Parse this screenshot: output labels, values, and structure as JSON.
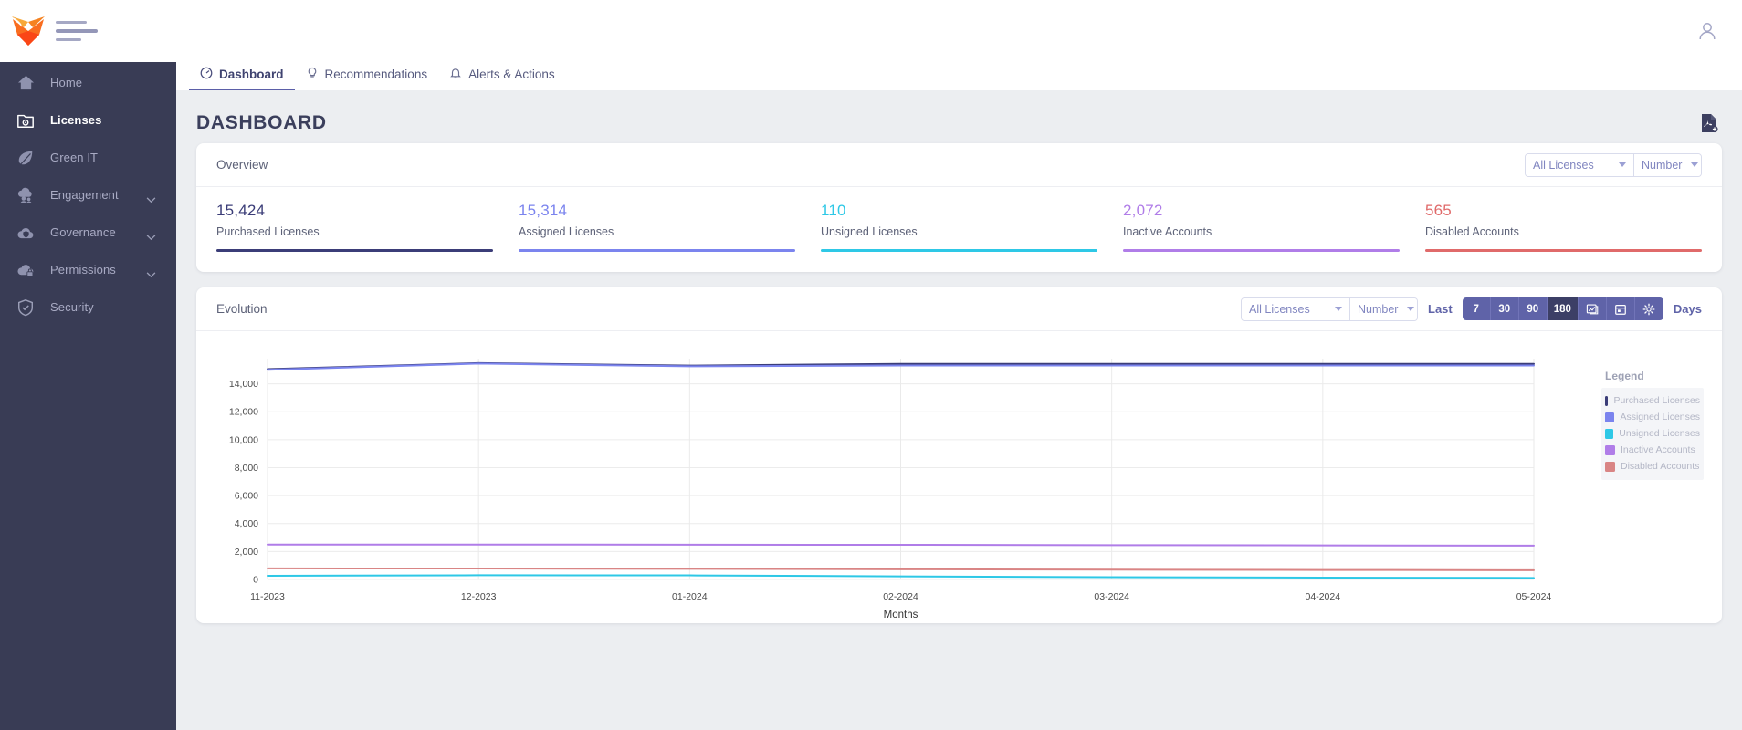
{
  "brand": {
    "logo_icon": "fox-logo",
    "menu_icon": "hamburger-lines"
  },
  "topbar": {
    "user_icon": "user-avatar-icon"
  },
  "sidebar": {
    "items": [
      {
        "label": "Home",
        "icon": "home-icon",
        "active": false,
        "expandable": false
      },
      {
        "label": "Licenses",
        "icon": "license-gear-icon",
        "active": true,
        "expandable": false
      },
      {
        "label": "Green IT",
        "icon": "leaf-icon",
        "active": false,
        "expandable": false
      },
      {
        "label": "Engagement",
        "icon": "people-cloud-icon",
        "active": false,
        "expandable": true
      },
      {
        "label": "Governance",
        "icon": "cloud-shield-icon",
        "active": false,
        "expandable": true
      },
      {
        "label": "Permissions",
        "icon": "cloud-lock-icon",
        "active": false,
        "expandable": true
      },
      {
        "label": "Security",
        "icon": "shield-check-icon",
        "active": false,
        "expandable": false
      }
    ]
  },
  "tabs": [
    {
      "label": "Dashboard",
      "icon": "gauge-icon",
      "active": true
    },
    {
      "label": "Recommendations",
      "icon": "lightbulb-icon",
      "active": false
    },
    {
      "label": "Alerts & Actions",
      "icon": "bell-icon",
      "active": false
    }
  ],
  "page": {
    "title": "DASHBOARD",
    "export_icon": "pdf-export-icon"
  },
  "overview": {
    "title": "Overview",
    "filter_license": "All Licenses",
    "filter_unit": "Number",
    "kpis": [
      {
        "value": "15,424",
        "label": "Purchased Licenses",
        "color": "#3b3d78"
      },
      {
        "value": "15,314",
        "label": "Assigned Licenses",
        "color": "#7b84ee"
      },
      {
        "value": "110",
        "label": "Unsigned Licenses",
        "color": "#2ec8e6"
      },
      {
        "value": "2,072",
        "label": "Inactive Accounts",
        "color": "#b07de8"
      },
      {
        "value": "565",
        "label": "Disabled Accounts",
        "color": "#e06a6a"
      }
    ]
  },
  "evolution": {
    "title": "Evolution",
    "filter_license": "All Licenses",
    "filter_unit": "Number",
    "last_label": "Last",
    "days_label": "Days",
    "ranges": [
      {
        "label": "7",
        "active": false
      },
      {
        "label": "30",
        "active": false
      },
      {
        "label": "90",
        "active": false
      },
      {
        "label": "180",
        "active": true
      }
    ],
    "extra_buttons": [
      {
        "icon": "chart-preset-icon"
      },
      {
        "icon": "calendar-icon"
      },
      {
        "icon": "gear-icon"
      }
    ],
    "legend_title": "Legend"
  },
  "chart_data": {
    "type": "line",
    "title": "Evolution",
    "xlabel": "Months",
    "ylabel": "",
    "categories": [
      "11-2023",
      "12-2023",
      "01-2024",
      "02-2024",
      "03-2024",
      "04-2024",
      "05-2024"
    ],
    "ylim": [
      0,
      15800
    ],
    "yticks": [
      0,
      2000,
      4000,
      6000,
      8000,
      10000,
      12000,
      14000
    ],
    "ytick_labels": [
      "0",
      "2,000",
      "4,000",
      "6,000",
      "8,000",
      "10,000",
      "12,000",
      "14,000"
    ],
    "grid": true,
    "legend_position": "right",
    "series": [
      {
        "name": "Purchased Licenses",
        "color": "#3b3d78",
        "values": [
          15050,
          15480,
          15300,
          15424,
          15424,
          15424,
          15424
        ]
      },
      {
        "name": "Assigned Licenses",
        "color": "#7b84ee",
        "values": [
          15000,
          15450,
          15250,
          15314,
          15314,
          15314,
          15314
        ]
      },
      {
        "name": "Unsigned Licenses",
        "color": "#2ec8e6",
        "values": [
          260,
          300,
          290,
          220,
          160,
          130,
          110
        ]
      },
      {
        "name": "Inactive Accounts",
        "color": "#b07de8",
        "values": [
          2500,
          2500,
          2490,
          2480,
          2460,
          2440,
          2420
        ]
      },
      {
        "name": "Disabled Accounts",
        "color": "#d98585",
        "values": [
          790,
          780,
          760,
          730,
          700,
          680,
          660
        ]
      }
    ]
  }
}
